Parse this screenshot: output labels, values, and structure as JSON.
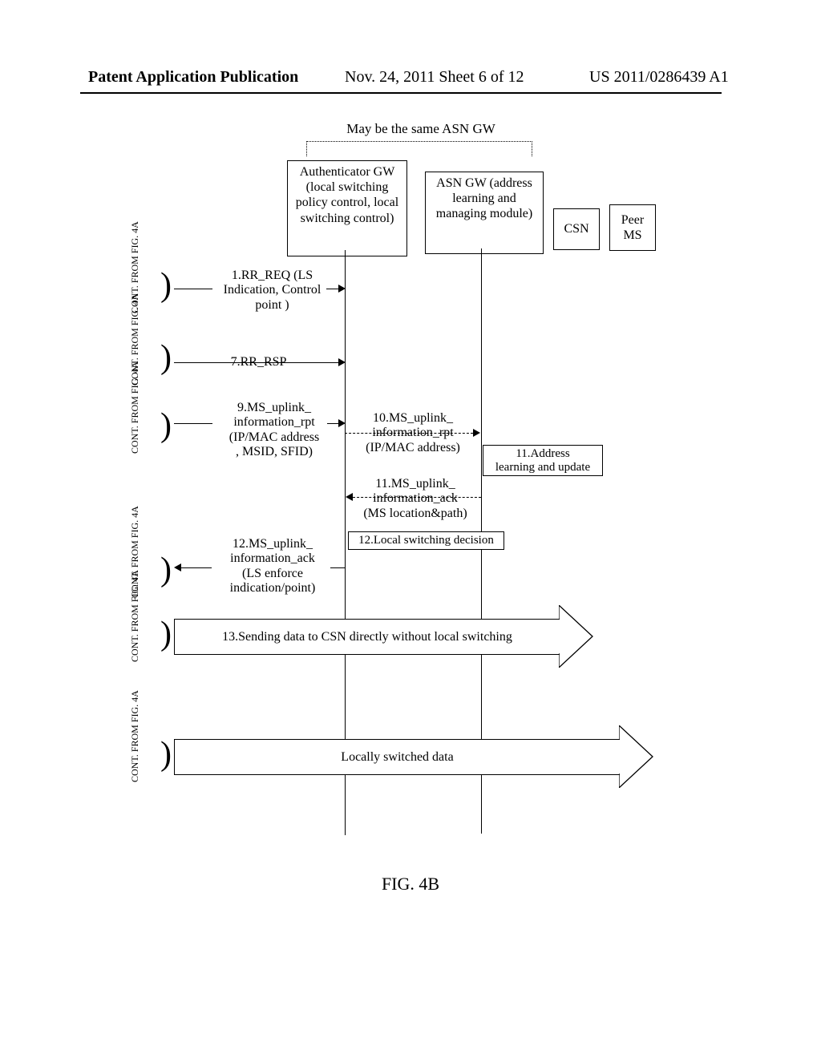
{
  "header": {
    "left": "Patent Application Publication",
    "mid": "Nov. 24, 2011  Sheet 6 of 12",
    "right": "US 2011/0286439 A1"
  },
  "top_note": "May be the same ASN GW",
  "entities": {
    "auth": "Authenticator GW (local switching policy control, local switching control)",
    "asn": "ASN GW (address learning and managing module)",
    "csn": "CSN",
    "peer": "Peer MS"
  },
  "cont": "CONT. FROM FIG. 4A",
  "msgs": {
    "m1": "1.RR_REQ\n(LS Indication,\nControl point )",
    "m7": "7.RR_RSP",
    "m9": "9.MS_uplink_\ninformation_rpt\n(IP/MAC address\n, MSID, SFID)",
    "m10": "10.MS_uplink_\ninformation_rpt\n(IP/MAC address)",
    "m11a": "11.Address\nlearning and update",
    "m11b": "11.MS_uplink_\ninformation_ack\n(MS location&path)",
    "m12decision": "12.Local switching decision",
    "m12": "12.MS_uplink_\ninformation_ack\n(LS enforce\nindication/point)",
    "m13": "13.Sending data to CSN directly without local switching",
    "last": "Locally switched data"
  },
  "figure": "FIG. 4B"
}
